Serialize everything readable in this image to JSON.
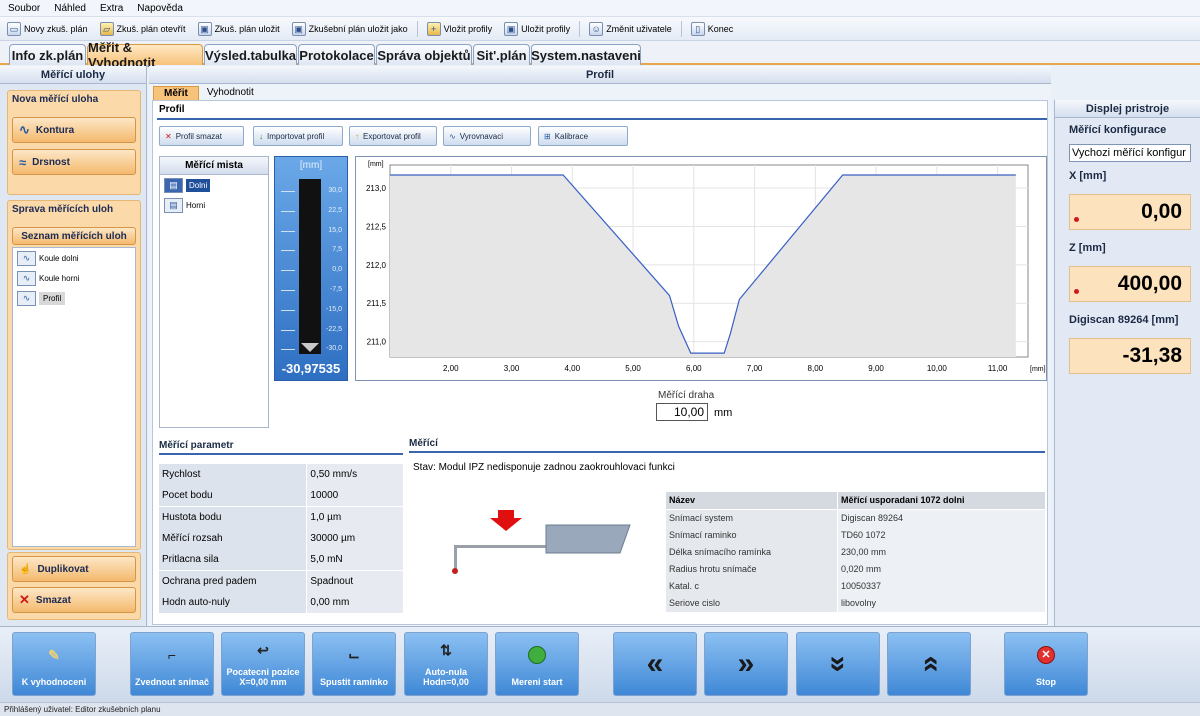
{
  "menu": [
    "Soubor",
    "Náhled",
    "Extra",
    "Napověda"
  ],
  "toolbar": [
    {
      "label": "Novy zkuš. plán",
      "icon": "new-document-icon"
    },
    {
      "label": "Zkuš. plán otevřít",
      "icon": "open-folder-icon"
    },
    {
      "label": "Zkuš. plán uložit",
      "icon": "save-disk-icon"
    },
    {
      "label": "Zkušební plán uložit jako",
      "icon": "save-as-icon"
    },
    {
      "label": "Vložit profily",
      "icon": "insert-profiles-icon"
    },
    {
      "label": "Uložit profily",
      "icon": "save-profiles-icon"
    },
    {
      "label": "Změnit uživatele",
      "icon": "users-icon"
    },
    {
      "label": "Konec",
      "icon": "exit-door-icon"
    }
  ],
  "tabs": [
    "Info zk.plán",
    "Měřit & Vyhodnotit",
    "Výsled.tabulka",
    "Protokolace",
    "Správa objektů",
    "Sit'.plán",
    "System.nastaveni"
  ],
  "left": {
    "title": "Měřící ulohy",
    "new_group": "Nova měřící uloha",
    "kontura": "Kontura",
    "drsnost": "Drsnost",
    "manage": "Sprava měřících uloh",
    "list_header": "Seznam měřících uloh",
    "list": [
      "Koule dolni",
      "Koule horni",
      "Profil"
    ],
    "duplicate": "Duplikovat",
    "delete": "Smazat"
  },
  "center": {
    "title": "Profil",
    "subtabs": [
      "Měřit",
      "Vyhodnotit"
    ],
    "section": "Profil",
    "buttons": [
      "Profil smazat",
      "Importovat profil",
      "Exportovat profil",
      "Vyrovnavaci",
      "Kalibrace"
    ],
    "points_title": "Měřící mista",
    "points": [
      "Dolni",
      "Horni"
    ],
    "gauge_unit": "[mm]",
    "gauge_ticks": [
      "30,0",
      "22,5",
      "15,0",
      "7,5",
      "0,0",
      "-7,5",
      "-15,0",
      "-22,5",
      "-30,0"
    ],
    "gauge_value": "-30,97535",
    "chart_y_unit": "[mm]",
    "chart_x_unit": "[mm]",
    "path_label": "Měřící draha",
    "path_value": "10,00",
    "path_unit": "mm",
    "params_title": "Měřící parametr",
    "params": [
      {
        "k": "Rychlost",
        "v": "0,50 mm/s"
      },
      {
        "k": "Pocet bodu",
        "v": "10000"
      },
      {
        "k": "Hustota bodu",
        "v": "1,0 µm"
      },
      {
        "k": "Měřící rozsah",
        "v": "30000 µm"
      },
      {
        "k": "Pritlacna sila",
        "v": "5,0 mN"
      },
      {
        "k": "Ochrana pred padem",
        "v": "Spadnout"
      },
      {
        "k": "Hodn auto-nuly",
        "v": "0,00 mm"
      }
    ],
    "meas_title": "Měřící",
    "status": "Stav: Modul IPZ nedisponuje zadnou zaokrouhlovaci funkci",
    "info_header": [
      "Název",
      "Měřící usporadani 1072 dolni"
    ],
    "info": [
      {
        "k": "Snímací system",
        "v": "Digiscan 89264"
      },
      {
        "k": "Snímací raminko",
        "v": "TD60 1072"
      },
      {
        "k": "Délka snímacího ramínka",
        "v": "230,00 mm"
      },
      {
        "k": "Radius hrotu snímače",
        "v": "0,020 mm"
      },
      {
        "k": "Katal. c",
        "v": "10050337"
      },
      {
        "k": "Seriove cislo",
        "v": "libovolny"
      }
    ]
  },
  "right": {
    "title": "Displej pristroje",
    "config_label": "Měřící konfigurace",
    "config_value": "Vychozi měřící konfigur",
    "x_label": "X [mm]",
    "x_value": "0,00",
    "z_label": "Z [mm]",
    "z_value": "400,00",
    "d_label": "Digiscan 89264 [mm]",
    "d_value": "-31,38"
  },
  "bottom": [
    {
      "label": "K vyhodnoceni",
      "icon": "pencil-icon"
    },
    {
      "label": "Zvednout snímač",
      "icon": "lift-probe-icon"
    },
    {
      "label": "Pocatecni pozice X=0,00 mm",
      "icon": "return-arrow-icon"
    },
    {
      "label": "Spustit ramínko",
      "icon": "lower-arm-icon"
    },
    {
      "label": "Auto-nula Hodn=0,00",
      "icon": "auto-zero-icon"
    },
    {
      "label": "Mereni start",
      "icon": "start-icon"
    },
    {
      "label": "",
      "icon": "double-left-icon"
    },
    {
      "label": "",
      "icon": "double-right-icon"
    },
    {
      "label": "",
      "icon": "double-down-icon"
    },
    {
      "label": "",
      "icon": "double-up-icon"
    },
    {
      "label": "Stop",
      "icon": "stop-icon"
    }
  ],
  "statusbar": "Přihlášený uživatel:   Editor zkušebních planu",
  "chart_data": {
    "type": "line",
    "xlabel": "[mm]",
    "ylabel": "[mm]",
    "xlim": [
      1.0,
      11.5
    ],
    "ylim": [
      210.8,
      213.3
    ],
    "xticks": [
      2.0,
      3.0,
      4.0,
      5.0,
      6.0,
      7.0,
      8.0,
      9.0,
      10.0,
      11.0
    ],
    "xtick_labels": [
      "2,00",
      "3,00",
      "4,00",
      "5,00",
      "6,00",
      "7,00",
      "8,00",
      "9,00",
      "10,00",
      "11,00"
    ],
    "yticks": [
      211.0,
      211.5,
      212.0,
      212.5,
      213.0
    ],
    "ytick_labels": [
      "211,0",
      "211,5",
      "212,0",
      "212,5",
      "213,0"
    ],
    "grid": true,
    "series": [
      {
        "x": [
          1.0,
          3.85,
          5.6,
          5.75,
          5.95,
          6.5,
          6.6,
          6.75,
          8.45,
          11.3
        ],
        "y": [
          213.17,
          213.17,
          211.6,
          211.2,
          210.85,
          210.85,
          211.1,
          211.55,
          213.17,
          213.17
        ]
      }
    ]
  }
}
